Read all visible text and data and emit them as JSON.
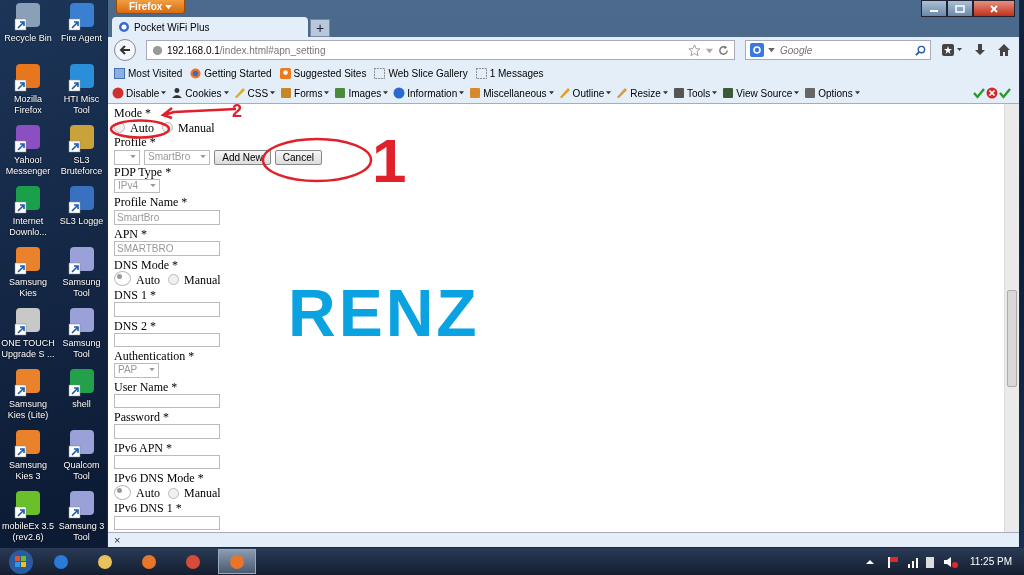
{
  "desktop_icons": [
    {
      "label": "Recycle Bin"
    },
    {
      "label": "Fire Agent"
    },
    {
      "label": "Mozilla Firefox"
    },
    {
      "label": "HTI Misc Tool"
    },
    {
      "label": "Yahoo! Messenger"
    },
    {
      "label": "SL3 Bruteforce"
    },
    {
      "label": "Internet Downlo..."
    },
    {
      "label": "SL3 Logge"
    },
    {
      "label": "Samsung Kies"
    },
    {
      "label": "Samsung Tool"
    },
    {
      "label": "ONE TOUCH Upgrade S ..."
    },
    {
      "label": "Samsung Tool"
    },
    {
      "label": "Samsung Kies (Lite)"
    },
    {
      "label": "shell"
    },
    {
      "label": "Samsung Kies 3"
    },
    {
      "label": "Qualcom Tool"
    },
    {
      "label": "mobileEx 3.5 (rev2.6)"
    },
    {
      "label": "Samsung 3 Tool"
    }
  ],
  "browser": {
    "menu_button": "Firefox",
    "tabs": [
      {
        "title": "Pocket WiFi Plus",
        "selected": true
      }
    ],
    "new_tab": "+",
    "url": {
      "host": "192.168.0.1",
      "path": "/index.html#apn_setting"
    },
    "search": {
      "placeholder": "Google"
    },
    "bookmarks": [
      {
        "label": "Most Visited"
      },
      {
        "label": "Getting Started"
      },
      {
        "label": "Suggested Sites"
      },
      {
        "label": "Web Slice Gallery"
      },
      {
        "label": "1 Messages"
      }
    ],
    "dev_toolbar": [
      {
        "label": "Disable"
      },
      {
        "label": "Cookies"
      },
      {
        "label": "CSS"
      },
      {
        "label": "Forms"
      },
      {
        "label": "Images"
      },
      {
        "label": "Information"
      },
      {
        "label": "Miscellaneous"
      },
      {
        "label": "Outline"
      },
      {
        "label": "Resize"
      },
      {
        "label": "Tools"
      },
      {
        "label": "View Source"
      },
      {
        "label": "Options"
      }
    ],
    "addon_bar_close": "×"
  },
  "form": [
    {
      "kind": "label",
      "text": "Mode *"
    },
    {
      "kind": "radios",
      "options": [
        {
          "label": "Auto",
          "selected": false
        },
        {
          "label": "Manual",
          "selected": false
        }
      ]
    },
    {
      "kind": "label",
      "text": "Profile *"
    },
    {
      "kind": "profile",
      "value": "SmartBro",
      "buttons": [
        "Add New",
        "Cancel"
      ]
    },
    {
      "kind": "label",
      "text": "PDP Type *"
    },
    {
      "kind": "select",
      "value": "IPv4"
    },
    {
      "kind": "label",
      "text": "Profile Name *"
    },
    {
      "kind": "input",
      "value": "SmartBro"
    },
    {
      "kind": "label",
      "text": "APN *"
    },
    {
      "kind": "input",
      "value": "SMARTBRO"
    },
    {
      "kind": "label",
      "text": "DNS Mode *"
    },
    {
      "kind": "radios",
      "options": [
        {
          "label": "Auto",
          "selected": true
        },
        {
          "label": "Manual",
          "selected": false
        }
      ]
    },
    {
      "kind": "label",
      "text": "DNS 1 *"
    },
    {
      "kind": "input"
    },
    {
      "kind": "label",
      "text": "DNS 2 *"
    },
    {
      "kind": "input"
    },
    {
      "kind": "label",
      "text": "Authentication *"
    },
    {
      "kind": "select",
      "value": "PAP"
    },
    {
      "kind": "label",
      "text": "User Name *"
    },
    {
      "kind": "input"
    },
    {
      "kind": "label",
      "text": "Password *"
    },
    {
      "kind": "input"
    },
    {
      "kind": "label",
      "text": "IPv6 APN *"
    },
    {
      "kind": "input"
    },
    {
      "kind": "label",
      "text": "IPv6 DNS Mode *"
    },
    {
      "kind": "radios",
      "options": [
        {
          "label": "Auto",
          "selected": true
        },
        {
          "label": "Manual",
          "selected": false
        }
      ]
    },
    {
      "kind": "label",
      "text": "IPv6 DNS 1 *"
    },
    {
      "kind": "input"
    }
  ],
  "annotations": {
    "marker_1": "1",
    "marker_2": "2",
    "overlay_text": "RENZ"
  },
  "taskbar": {
    "apps": [
      {
        "selected": false
      },
      {
        "selected": false
      },
      {
        "selected": false
      },
      {
        "selected": false
      },
      {
        "selected": true
      }
    ],
    "clock": "11:25 PM"
  }
}
